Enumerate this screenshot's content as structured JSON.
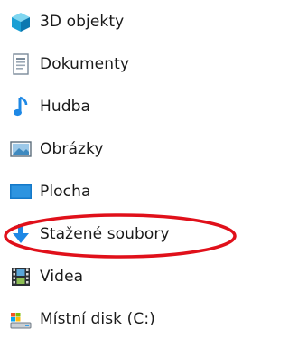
{
  "nav_items": [
    {
      "label": "3D objekty",
      "icon": "3d-objects-icon"
    },
    {
      "label": "Dokumenty",
      "icon": "documents-icon"
    },
    {
      "label": "Hudba",
      "icon": "music-icon"
    },
    {
      "label": "Obrázky",
      "icon": "pictures-icon"
    },
    {
      "label": "Plocha",
      "icon": "desktop-icon"
    },
    {
      "label": "Stažené soubory",
      "icon": "downloads-icon",
      "highlighted": true
    },
    {
      "label": "Videa",
      "icon": "videos-icon"
    },
    {
      "label": "Místní disk (C:)",
      "icon": "local-disk-icon"
    }
  ],
  "colors": {
    "highlight_ellipse": "#e0101a",
    "accent_blue": "#1e88e5"
  }
}
